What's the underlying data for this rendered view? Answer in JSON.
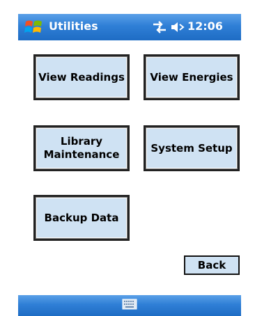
{
  "titlebar": {
    "app_title": "Utilities",
    "clock": "12:06",
    "start_icon": "windows-flag-icon",
    "sync_icon": "sync-arrows-icon",
    "volume_icon": "speaker-volume-icon"
  },
  "buttons": {
    "view_readings": "View Readings",
    "view_energies": "View Energies",
    "library_maintenance": "Library\nMaintenance",
    "system_setup": "System Setup",
    "backup_data": "Backup Data",
    "back": "Back"
  },
  "bottombar": {
    "keyboard_icon": "keyboard-icon"
  },
  "colors": {
    "titlebar_blue": "#2f7fd6",
    "button_fill": "#cfe2f3",
    "border": "#222222"
  }
}
